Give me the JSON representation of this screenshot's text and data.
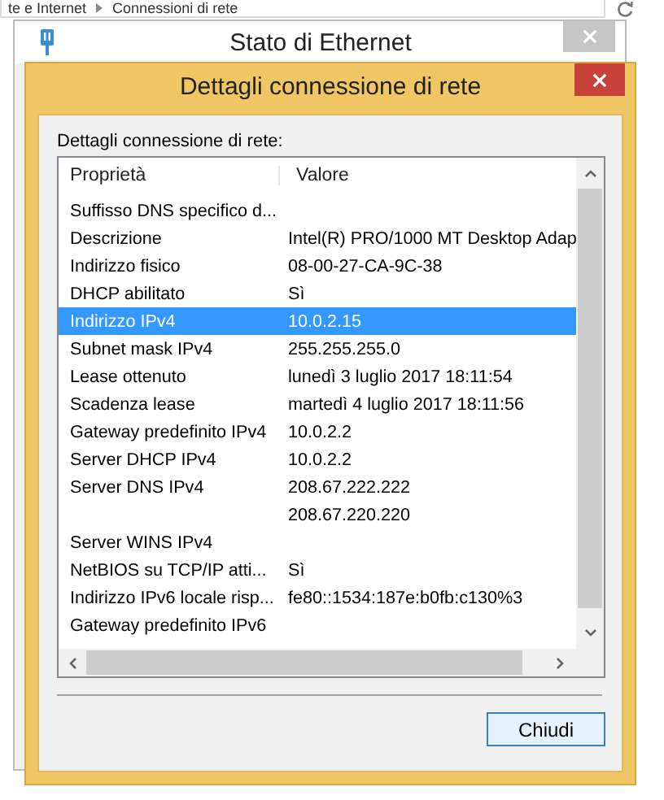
{
  "explorer": {
    "breadcrumb": [
      "te e Internet",
      "Connessioni di rete"
    ]
  },
  "status_window": {
    "title": "Stato di Ethernet"
  },
  "dialog": {
    "title": "Dettagli connessione di rete",
    "label": "Dettagli connessione di rete:",
    "columns": [
      "Proprietà",
      "Valore"
    ],
    "rows": [
      {
        "property": "Suffisso DNS specifico d...",
        "selected": false
      },
      {
        "property": "Descrizione",
        "value": "Intel(R) PRO/1000 MT Desktop Adap",
        "selected": false
      },
      {
        "property": "Indirizzo fisico",
        "value": "08-00-27-CA-9C-38",
        "selected": false
      },
      {
        "property": "DHCP abilitato",
        "value": "Sì",
        "selected": false
      },
      {
        "property": "Indirizzo IPv4",
        "value": "10.0.2.15",
        "selected": true
      },
      {
        "property": "Subnet mask IPv4",
        "value": "255.255.255.0",
        "selected": false
      },
      {
        "property": "Lease ottenuto",
        "value": "lunedì 3 luglio 2017 18:11:54",
        "selected": false
      },
      {
        "property": "Scadenza lease",
        "value": "martedì 4 luglio 2017 18:11:56",
        "selected": false
      },
      {
        "property": "Gateway predefinito IPv4",
        "value": "10.0.2.2",
        "selected": false
      },
      {
        "property": "Server DHCP IPv4",
        "value": "10.0.2.2",
        "selected": false
      },
      {
        "property": "Server DNS IPv4",
        "value": "208.67.222.222",
        "selected": false
      },
      {
        "value": "208.67.220.220",
        "selected": false
      },
      {
        "property": "Server WINS IPv4",
        "selected": false
      },
      {
        "property": "NetBIOS su TCP/IP atti...",
        "value": "Sì",
        "selected": false
      },
      {
        "property": "Indirizzo IPv6 locale risp...",
        "value": "fe80::1534:187e:b0fb:c130%3",
        "selected": false
      },
      {
        "property": "Gateway predefinito IPv6",
        "selected": false
      }
    ],
    "button": "Chiudi"
  }
}
